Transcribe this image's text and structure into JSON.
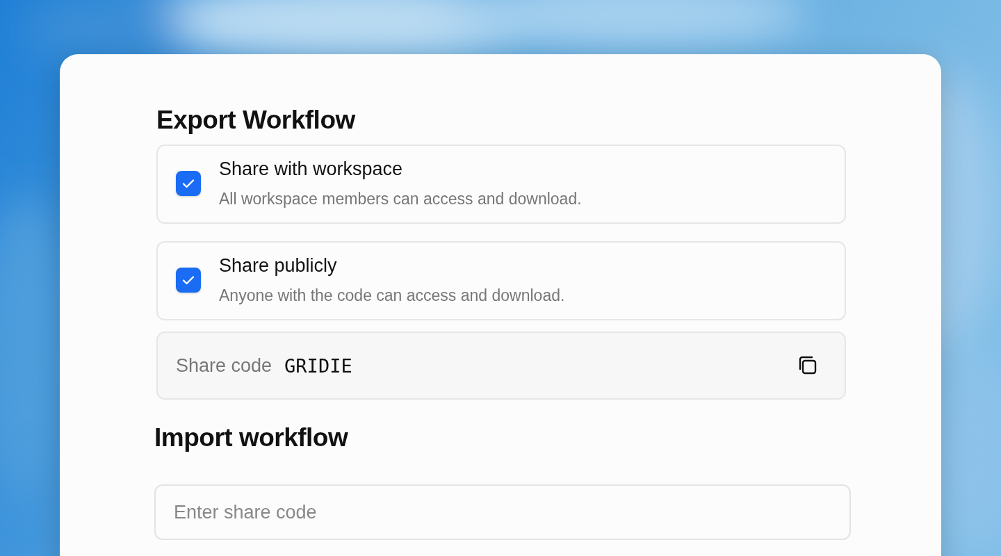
{
  "export": {
    "title": "Export Workflow",
    "options": [
      {
        "label": "Share with workspace",
        "description": "All workspace members can access and download.",
        "checked": true
      },
      {
        "label": "Share publicly",
        "description": "Anyone with the code can access and download.",
        "checked": true
      }
    ],
    "share_code": {
      "label": "Share code",
      "value": "GRIDIE"
    }
  },
  "import": {
    "title": "Import workflow",
    "field": {
      "placeholder": "Enter share code"
    }
  }
}
